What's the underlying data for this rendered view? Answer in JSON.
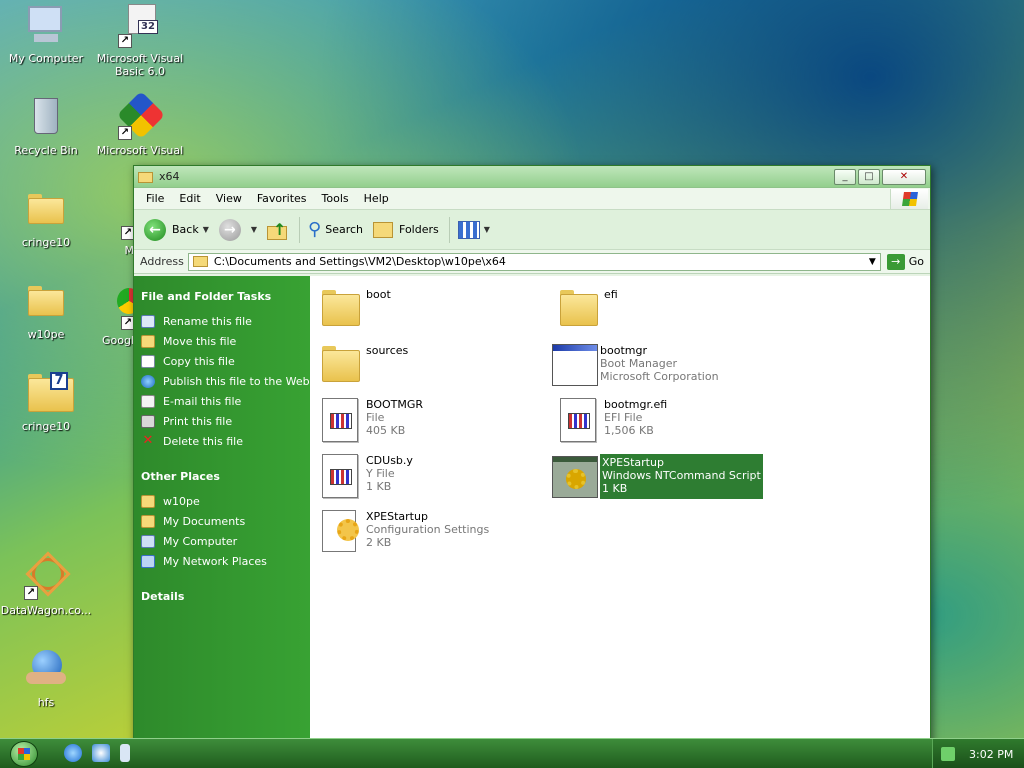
{
  "desktop": {
    "icons": [
      {
        "label": "My Computer"
      },
      {
        "label": "Microsoft Visual Basic 6.0"
      },
      {
        "label": "Recycle Bin"
      },
      {
        "label": "Microsoft Visual C++ 6.0"
      },
      {
        "label": "cringe10"
      },
      {
        "label": "M"
      },
      {
        "label": "w10pe"
      },
      {
        "label": "Googl"
      },
      {
        "label": "cringe10"
      },
      {
        "label": "DataWagon.co..."
      },
      {
        "label": "hfs"
      }
    ],
    "visual_basic_badge": "32",
    "cringe_badge": "7"
  },
  "window": {
    "title": "x64",
    "menu": [
      "File",
      "Edit",
      "View",
      "Favorites",
      "Tools",
      "Help"
    ],
    "toolbar": {
      "back": "Back",
      "search": "Search",
      "folders": "Folders"
    },
    "address": {
      "label": "Address",
      "path": "C:\\Documents and Settings\\VM2\\Desktop\\w10pe\\x64",
      "go": "Go"
    },
    "tasks": {
      "file_folder_header": "File and Folder Tasks",
      "file_folder_items": [
        "Rename this file",
        "Move this file",
        "Copy this file",
        "Publish this file to the Web",
        "E-mail this file",
        "Print this file",
        "Delete this file"
      ],
      "other_places_header": "Other Places",
      "other_places_items": [
        "w10pe",
        "My Documents",
        "My Computer",
        "My Network Places"
      ],
      "details_header": "Details"
    },
    "files": [
      {
        "name": "boot",
        "type": "",
        "size": ""
      },
      {
        "name": "efi",
        "type": "",
        "size": ""
      },
      {
        "name": "sources",
        "type": "",
        "size": ""
      },
      {
        "name": "bootmgr",
        "type": "Boot Manager",
        "size": "Microsoft Corporation"
      },
      {
        "name": "BOOTMGR",
        "type": "File",
        "size": "405 KB"
      },
      {
        "name": "bootmgr.efi",
        "type": "EFI File",
        "size": "1,506 KB"
      },
      {
        "name": "CDUsb.y",
        "type": "Y File",
        "size": "1 KB"
      },
      {
        "name": "XPEStartup",
        "type": "Windows NTCommand Script",
        "size": "1 KB",
        "selected": true
      },
      {
        "name": "XPEStartup",
        "type": "Configuration Settings",
        "size": "2 KB"
      }
    ]
  },
  "taskbar": {
    "clock": "3:02 PM"
  },
  "colors": {
    "task_pane": "#2e8a2b",
    "selection": "#2e7d32",
    "taskbar": "#2a6b27"
  }
}
